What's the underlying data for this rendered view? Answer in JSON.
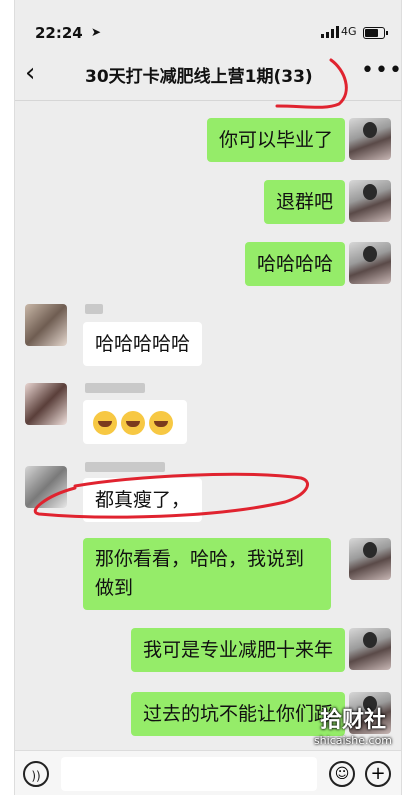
{
  "status_bar": {
    "time": "22:24",
    "network": "4G"
  },
  "header": {
    "back": "‹",
    "title": "30天打卡减肥线上营1期",
    "count": "(33)",
    "more": "•••"
  },
  "messages": {
    "m1": "你可以毕业了",
    "m2": "退群吧",
    "m3": "哈哈哈哈",
    "m4": "哈哈哈哈哈",
    "m5_emojis": [
      "crying-laughing",
      "crying-laughing",
      "crying-laughing"
    ],
    "m6": "都真瘦了，",
    "m7": "那你看看，哈哈，我说到做到",
    "m8": "我可是专业减肥十来年",
    "m9": "过去的坑不能让你们踩"
  },
  "watermark": {
    "cn": "拾财社",
    "en": "shicaishe.com"
  },
  "colors": {
    "bubble_me": "#95ec69",
    "bubble_other": "#ffffff",
    "background": "#ededed",
    "annotation": "#e0232f"
  }
}
